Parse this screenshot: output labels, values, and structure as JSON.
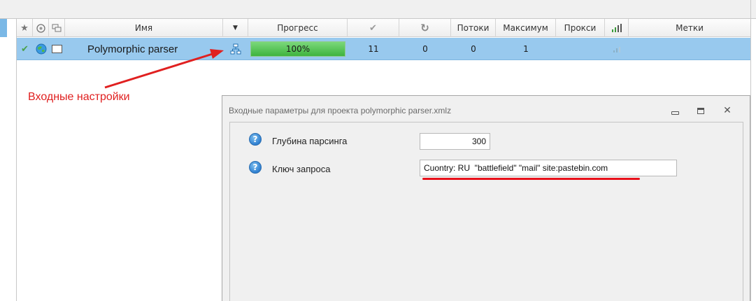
{
  "grid": {
    "columns": [
      {
        "name": "col-star",
        "label": "",
        "icon": "star-icon"
      },
      {
        "name": "col-globe",
        "label": "",
        "icon": "globe-icon"
      },
      {
        "name": "col-window",
        "label": "",
        "icon": "windows-icon"
      },
      {
        "name": "col-name",
        "label": "Имя"
      },
      {
        "name": "col-dropdown",
        "label": "",
        "icon": "dropdown-arrow-icon"
      },
      {
        "name": "col-progress",
        "label": "Прогресс"
      },
      {
        "name": "col-success",
        "label": "",
        "icon": "checkmark-icon"
      },
      {
        "name": "col-retry",
        "label": "",
        "icon": "refresh-icon"
      },
      {
        "name": "col-threads",
        "label": "Потоки"
      },
      {
        "name": "col-max",
        "label": "Максимум"
      },
      {
        "name": "col-proxy",
        "label": "Прокси"
      },
      {
        "name": "col-signal",
        "label": "",
        "icon": "signal-bars-icon"
      },
      {
        "name": "col-tags",
        "label": "Метки"
      }
    ],
    "row": {
      "status_icon": "checkmark-icon",
      "globe_icon": "globe-icon",
      "window_icon": "window-icon",
      "name": "Polymorphic parser",
      "settings_icon": "network-settings-icon",
      "progress_text": "100%",
      "progress_value": 1.0,
      "success": "11",
      "retries": "0",
      "threads": "0",
      "maximum": "1",
      "proxy": "",
      "signal_icon": "signal-bars-icon",
      "tags": ""
    }
  },
  "annotation": {
    "label": "Входные настройки",
    "color": "#e02020"
  },
  "dialog": {
    "title": "Входные параметры для проекта polymorphic parser.xmlz",
    "buttons": [
      "minimize-icon",
      "restore-icon",
      "close-icon"
    ],
    "params": [
      {
        "label": "Глубина парсинга",
        "value": "300",
        "icon": "help-icon"
      },
      {
        "label": "Ключ запроса",
        "value": "Cuontry: RU  \"battlefield\" \"mail\" site:pastebin.com",
        "icon": "help-icon"
      }
    ]
  },
  "colors": {
    "selection": "#98c9ee",
    "progress": "#4cc04c",
    "highlight": "#e8101a"
  }
}
